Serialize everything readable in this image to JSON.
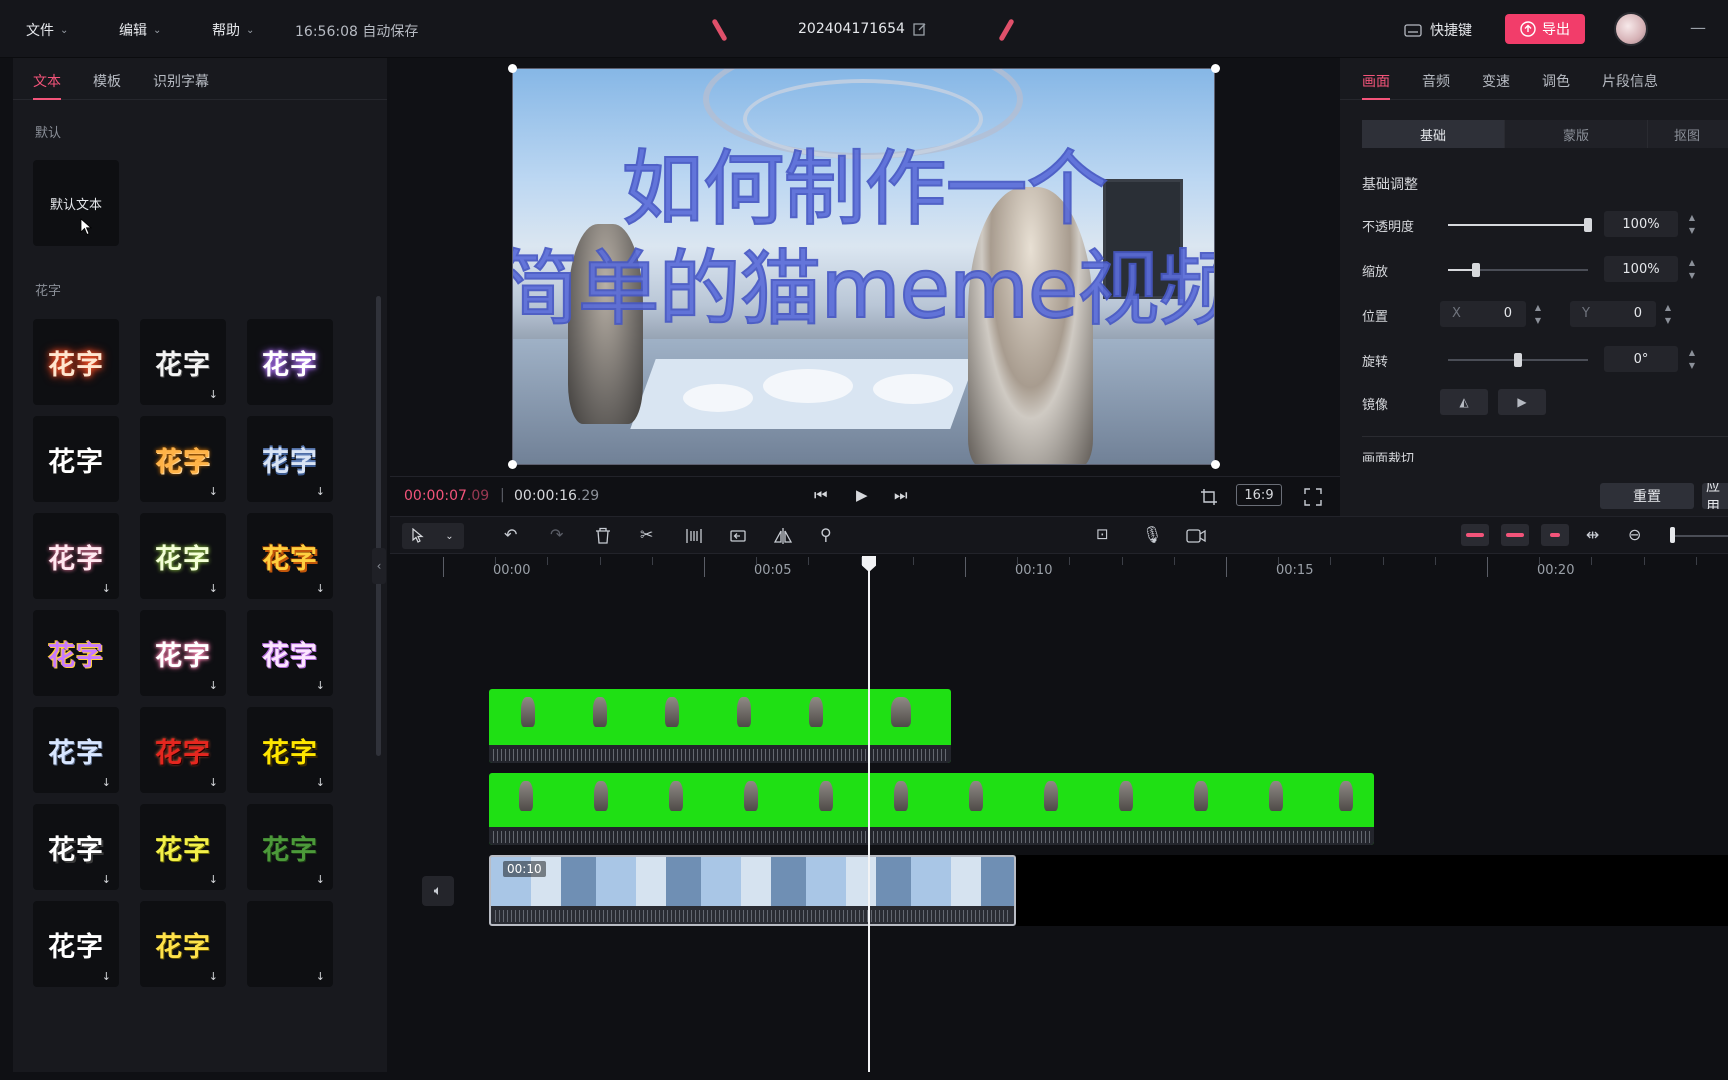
{
  "menu": {
    "file": "文件",
    "edit": "编辑",
    "help": "帮助",
    "autosave": "16:56:08 自动保存"
  },
  "project": {
    "title": "202404171654"
  },
  "header": {
    "shortcut_label": "快捷键",
    "export_label": "导出"
  },
  "left": {
    "tabs": [
      "文本",
      "模板",
      "识别字幕"
    ],
    "default_section": "默认",
    "default_text": "默认文本",
    "huazi_section": "花字",
    "huazi_label": "花字"
  },
  "preview": {
    "overlay_line1": "如何制作一个",
    "overlay_line2": "简单的猫meme视频",
    "current_time_main": "00:00:07",
    "current_time_frames": ".09",
    "total_time_main": "00:00:16",
    "total_time_frames": ".29",
    "ratio": "16:9"
  },
  "right": {
    "tabs": [
      "画面",
      "音频",
      "变速",
      "调色",
      "片段信息"
    ],
    "segments": [
      "基础",
      "蒙版",
      "抠图"
    ],
    "section_basic": "基础调整",
    "opacity_label": "不透明度",
    "opacity_value": "100%",
    "opacity_level": 1.0,
    "scale_label": "缩放",
    "scale_value": "100%",
    "scale_level": 0.2,
    "position_label": "位置",
    "x_key": "X",
    "x_value": "0",
    "y_key": "Y",
    "y_value": "0",
    "rotate_label": "旋转",
    "rotate_value": "0°",
    "rotate_level": 0.5,
    "mirror_label": "镜像",
    "crop_label": "画面裁切",
    "reset_label": "重置",
    "apply_label": "应用"
  },
  "timeline": {
    "ruler_labels": [
      "00:00",
      "00:05",
      "00:10",
      "00:15",
      "00:20"
    ],
    "main_clip_duration": "00:10",
    "playhead_time_seconds": 7.09
  },
  "colors": {
    "accent": "#f3547a",
    "export": "#f23d6a",
    "greenscreen": "#1fe014",
    "overlay_text": "#5b6dd9"
  }
}
